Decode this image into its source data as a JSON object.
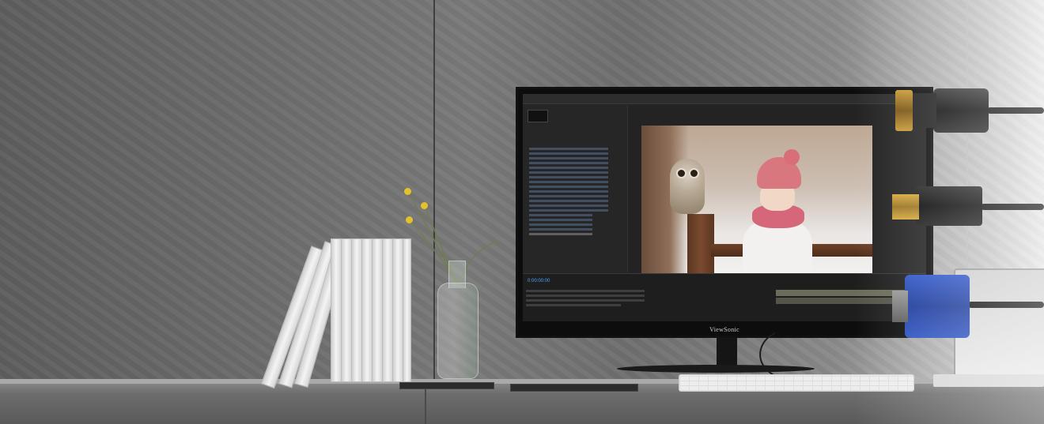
{
  "monitor": {
    "brand_label": "ViewSonic",
    "timecode": "0:00:00:00"
  },
  "scene": {
    "accent_gold": "#c89a37",
    "accent_vga_blue": "#2c52c2"
  }
}
